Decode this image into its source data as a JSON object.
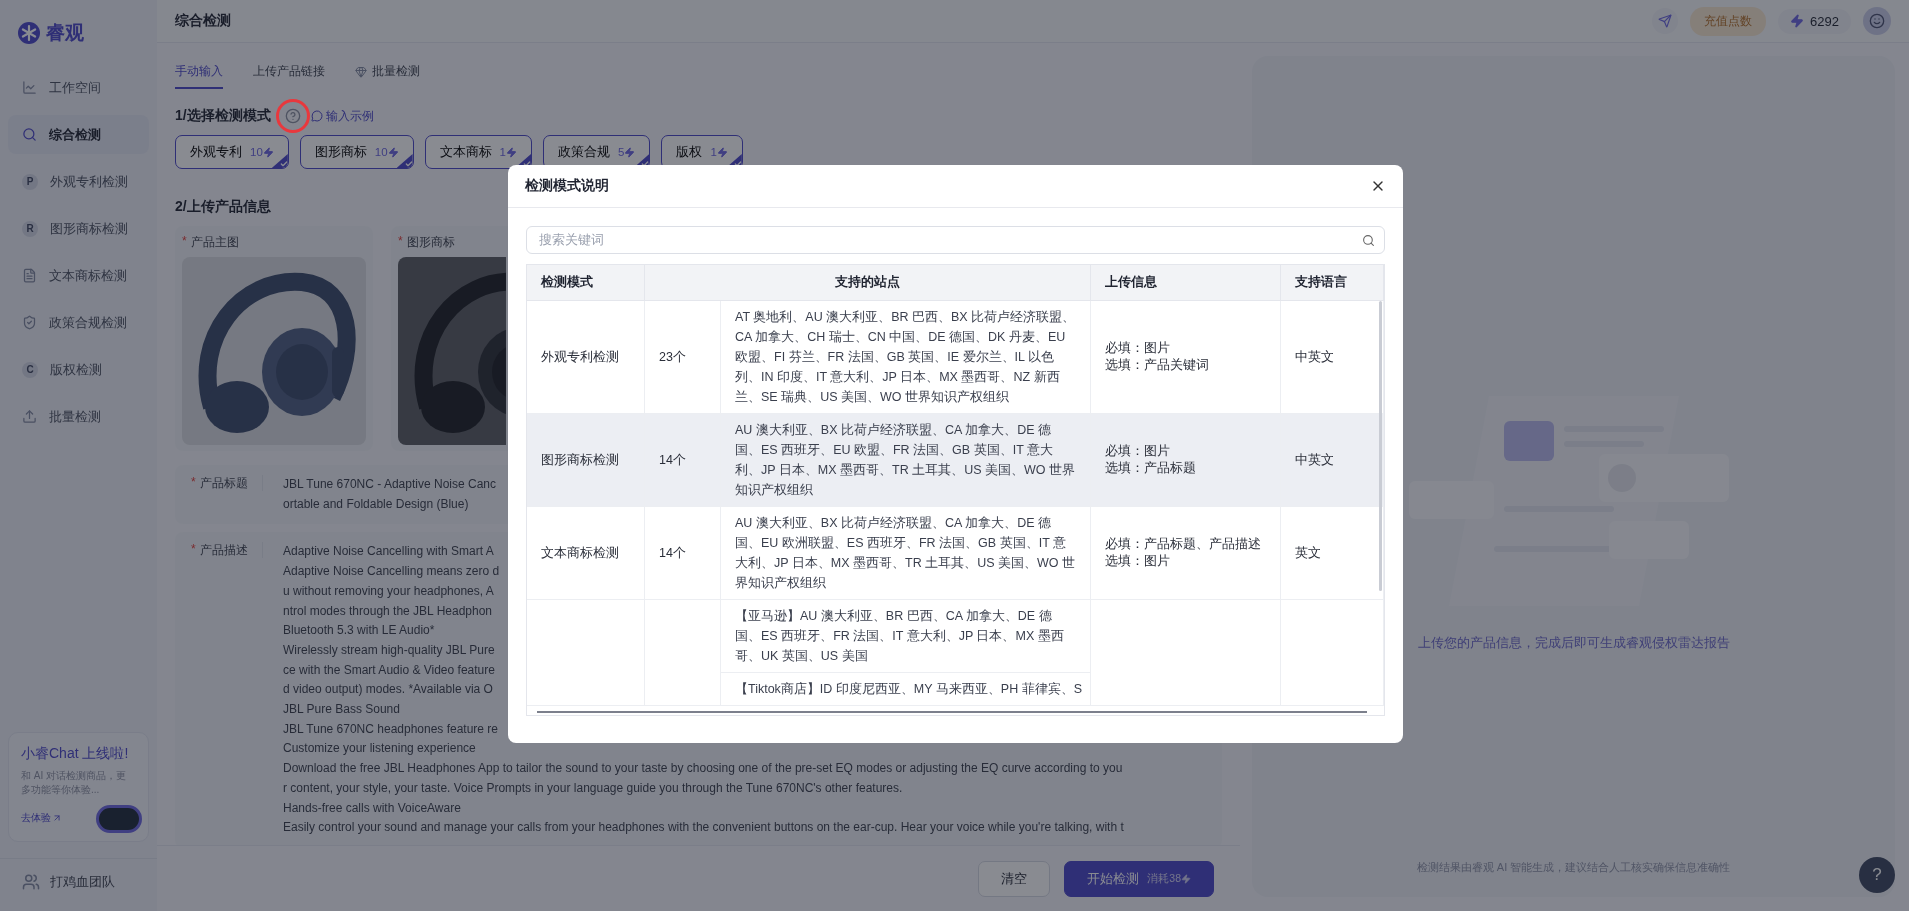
{
  "brand": "睿观",
  "sidebar": {
    "items": [
      {
        "label": "工作空间",
        "selected": false
      },
      {
        "label": "综合检测",
        "selected": true
      },
      {
        "label": "外观专利检测",
        "letter": "P",
        "selected": false
      },
      {
        "label": "图形商标检测",
        "letter": "R",
        "selected": false
      },
      {
        "label": "文本商标检测",
        "selected": false
      },
      {
        "label": "政策合规检测",
        "selected": false
      },
      {
        "label": "版权检测",
        "letter": "C",
        "selected": false
      },
      {
        "label": "批量检测",
        "selected": false
      }
    ],
    "promo": {
      "title": "小睿Chat 上线啦!",
      "text": "和 AI 对话检测商品，更多功能等你体验...",
      "link": "去体验"
    },
    "team": "打鸡血团队"
  },
  "header": {
    "title": "综合检测",
    "recharge": "充值点数",
    "points": "6292"
  },
  "tabs": [
    {
      "label": "手动输入",
      "selected": true
    },
    {
      "label": "上传产品链接",
      "selected": false
    },
    {
      "label": "批量检测",
      "selected": false
    }
  ],
  "step1": {
    "title": "1/选择检测模式",
    "example_link": "输入示例",
    "modes": [
      {
        "label": "外观专利",
        "cost": "10",
        "selected": true
      },
      {
        "label": "图形商标",
        "cost": "10",
        "selected": true
      },
      {
        "label": "文本商标",
        "cost": "1",
        "selected": true
      },
      {
        "label": "政策合规",
        "cost": "5",
        "selected": true
      },
      {
        "label": "版权",
        "cost": "1",
        "selected": true
      }
    ]
  },
  "step2": {
    "title": "2/上传产品信息",
    "images": [
      {
        "label": "产品主图",
        "required_mark": "*",
        "kind": "picture"
      },
      {
        "label": "图形商标",
        "required_mark": "*",
        "kind": "picture"
      }
    ],
    "product_title": {
      "label": "产品标题",
      "required_mark": "*",
      "lines": [
        "JBL Tune 670NC - Adaptive Noise Canc",
        "ortable and Foldable Design (Blue)"
      ]
    },
    "product_description": {
      "label": "产品描述",
      "required_mark": "*",
      "lines": [
        "Adaptive Noise Cancelling with Smart A",
        "Adaptive Noise Cancelling means zero d",
        "u without removing your headphones, A",
        "ntrol modes through the JBL Headphon",
        "Bluetooth 5.3 with LE Audio*",
        "Wirelessly stream high-quality JBL Pure",
        "ce with the Smart Audio & Video feature",
        "d video output) modes. *Available via O",
        "JBL Pure Bass Sound",
        "JBL Tune 670NC headphones feature re",
        "Customize your listening experience",
        "Download the free JBL Headphones App to tailor the sound to your taste by choosing one of the pre-set EQ modes or adjusting the EQ curve according to you",
        "r content, your style, your taste. Voice Prompts in your language guide you through the Tune 670NC's other features.",
        "Hands-free calls with VoiceAware",
        "Easily control your sound and manage your calls from your headphones with the convenient buttons on the ear-cup. Hear your voice while you're talking, with t"
      ]
    }
  },
  "actions": {
    "clear": "清空",
    "start": "开始检测",
    "start_cost": "消耗38"
  },
  "preview": {
    "caption": "上传您的产品信息，完成后即可生成睿观侵权雷达报告",
    "footer": "检测结果由睿观 AI 智能生成，建议结合人工核实确保信息准确性",
    "help": "?"
  },
  "modal": {
    "title": "检测模式说明",
    "search": {
      "placeholder": "搜索关键词"
    },
    "columns": [
      "检测模式",
      "支持的站点",
      "上传信息",
      "支持语言"
    ],
    "rows": [
      {
        "mode": "外观专利检测",
        "count": "23个",
        "hovered": false,
        "sites": [
          "AT 奥地利、AU 澳大利亚、BR 巴西、BX 比荷卢经济联盟、CA 加拿大、CH 瑞士、CN 中国、DE 德国、DK 丹麦、EU 欧盟、FI 芬兰、FR 法国、GB 英国、IE 爱尔兰、IL 以色列、IN 印度、IT 意大利、JP 日本、MX 墨西哥、NZ 新西兰、SE 瑞典、US 美国、WO 世界知识产权组织"
        ],
        "upload": [
          "必填：图片",
          "选填：产品关键词"
        ],
        "language": "中英文"
      },
      {
        "mode": "图形商标检测",
        "count": "14个",
        "hovered": true,
        "sites": [
          "AU 澳大利亚、BX 比荷卢经济联盟、CA 加拿大、DE 德国、ES 西班牙、EU 欧盟、FR 法国、GB 英国、IT 意大利、JP 日本、MX 墨西哥、TR 土耳其、US 美国、WO 世界知识产权组织"
        ],
        "upload": [
          "必填：图片",
          "选填：产品标题"
        ],
        "language": "中英文"
      },
      {
        "mode": "文本商标检测",
        "count": "14个",
        "hovered": false,
        "sites": [
          "AU 澳大利亚、BX 比荷卢经济联盟、CA 加拿大、DE 德国、EU 欧洲联盟、ES 西班牙、FR 法国、GB 英国、IT 意大利、JP 日本、MX 墨西哥、TR 土耳其、US 美国、WO 世界知识产权组织"
        ],
        "upload": [
          "必填：产品标题、产品描述",
          "选填：图片"
        ],
        "language": "英文"
      },
      {
        "hovered": false,
        "sites": [
          "【亚马逊】AU 澳大利亚、BR 巴西、CA 加拿大、DE 德国、ES 西班牙、FR 法国、IT 意大利、JP 日本、MX 墨西哥、UK 英国、US 美国",
          "【Tiktok商店】ID 印度尼西亚、MY 马来西亚、PH 菲律宾、S"
        ]
      }
    ]
  }
}
